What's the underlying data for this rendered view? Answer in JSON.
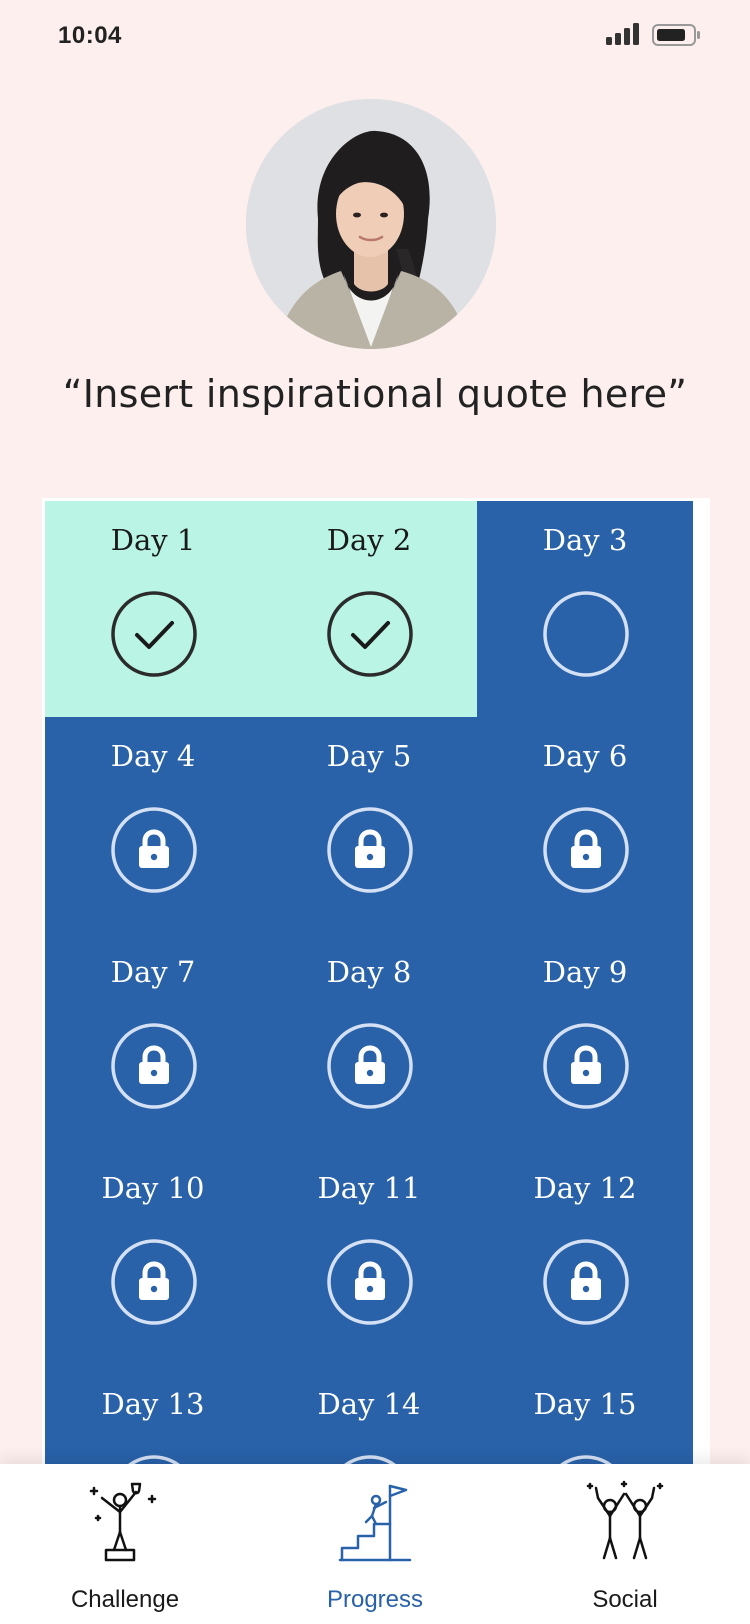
{
  "status_bar": {
    "time": "10:04"
  },
  "profile": {
    "quote": "“Insert inspirational quote here”"
  },
  "colors": {
    "background": "#fcefed",
    "tile_locked": "#2962a9",
    "tile_done": "#b9f4e4",
    "accent": "#2962a9"
  },
  "days": [
    {
      "label": "Day 1",
      "status": "completed",
      "icon": "check-circle-icon"
    },
    {
      "label": "Day 2",
      "status": "completed",
      "icon": "check-circle-icon"
    },
    {
      "label": "Day 3",
      "status": "current",
      "icon": "empty-circle-icon"
    },
    {
      "label": "Day 4",
      "status": "locked",
      "icon": "lock-icon"
    },
    {
      "label": "Day 5",
      "status": "locked",
      "icon": "lock-icon"
    },
    {
      "label": "Day 6",
      "status": "locked",
      "icon": "lock-icon"
    },
    {
      "label": "Day 7",
      "status": "locked",
      "icon": "lock-icon"
    },
    {
      "label": "Day 8",
      "status": "locked",
      "icon": "lock-icon"
    },
    {
      "label": "Day 9",
      "status": "locked",
      "icon": "lock-icon"
    },
    {
      "label": "Day 10",
      "status": "locked",
      "icon": "lock-icon"
    },
    {
      "label": "Day 11",
      "status": "locked",
      "icon": "lock-icon"
    },
    {
      "label": "Day 12",
      "status": "locked",
      "icon": "lock-icon"
    },
    {
      "label": "Day 13",
      "status": "locked",
      "icon": "lock-icon"
    },
    {
      "label": "Day 14",
      "status": "locked",
      "icon": "lock-icon"
    },
    {
      "label": "Day 15",
      "status": "locked",
      "icon": "lock-icon"
    }
  ],
  "tabs": [
    {
      "label": "Challenge",
      "icon": "trophy-person-icon",
      "active": false
    },
    {
      "label": "Progress",
      "icon": "climb-flag-icon",
      "active": true
    },
    {
      "label": "Social",
      "icon": "high-five-icon",
      "active": false
    }
  ]
}
